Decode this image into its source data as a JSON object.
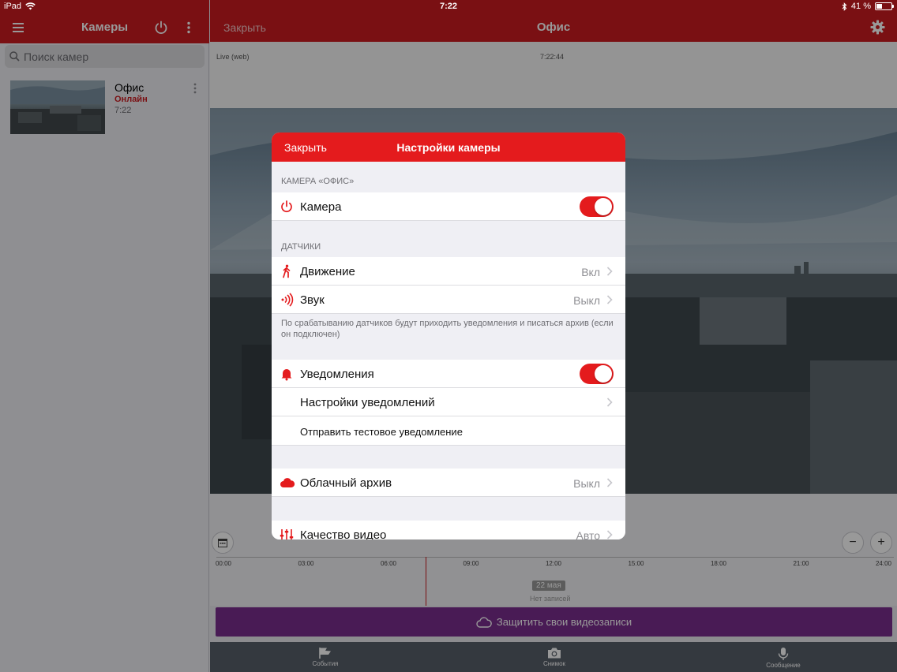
{
  "status_bar": {
    "device": "iPad",
    "time": "7:22",
    "battery": "41 %",
    "battery_level": 0.41
  },
  "sidebar": {
    "title": "Камеры",
    "search_placeholder": "Поиск камер",
    "cameras": [
      {
        "name": "Офис",
        "status": "Онлайн",
        "time": "7:22"
      }
    ]
  },
  "main": {
    "close_label": "Закрыть",
    "title": "Офис",
    "mode": "Live (web)",
    "clock": "7:22:44",
    "timeline": {
      "ticks": [
        "00:00",
        "03:00",
        "06:00",
        "09:00",
        "12:00",
        "15:00",
        "18:00",
        "21:00",
        "24:00"
      ],
      "date": "22 мая",
      "no_records": "Нет записей"
    },
    "protect_button": "Защитить свои видеозаписи",
    "tabs": [
      {
        "label": "События"
      },
      {
        "label": "Снимок"
      },
      {
        "label": "Сообщение"
      }
    ]
  },
  "modal": {
    "close_label": "Закрыть",
    "title": "Настройки камеры",
    "section_camera": "Камера «Офис»",
    "camera_row": {
      "label": "Камера",
      "on": true
    },
    "section_sensors": "Датчики",
    "motion": {
      "label": "Движение",
      "value": "Вкл"
    },
    "sound": {
      "label": "Звук",
      "value": "Выкл"
    },
    "sensors_note": "По срабатыванию датчиков будут приходить уведомления и писаться архив (если он подключен)",
    "notifications": {
      "label": "Уведомления",
      "on": true
    },
    "notification_settings": "Настройки уведомлений",
    "send_test": "Отправить тестовое уведомление",
    "cloud_archive": {
      "label": "Облачный архив",
      "value": "Выкл"
    },
    "video_quality": {
      "label": "Качество видео",
      "value": "Авто"
    }
  },
  "colors": {
    "brand_red": "#cc1c21",
    "modal_red": "#e41b1d",
    "protect_purple": "#7b2d8e",
    "tabbar": "#58606a"
  }
}
